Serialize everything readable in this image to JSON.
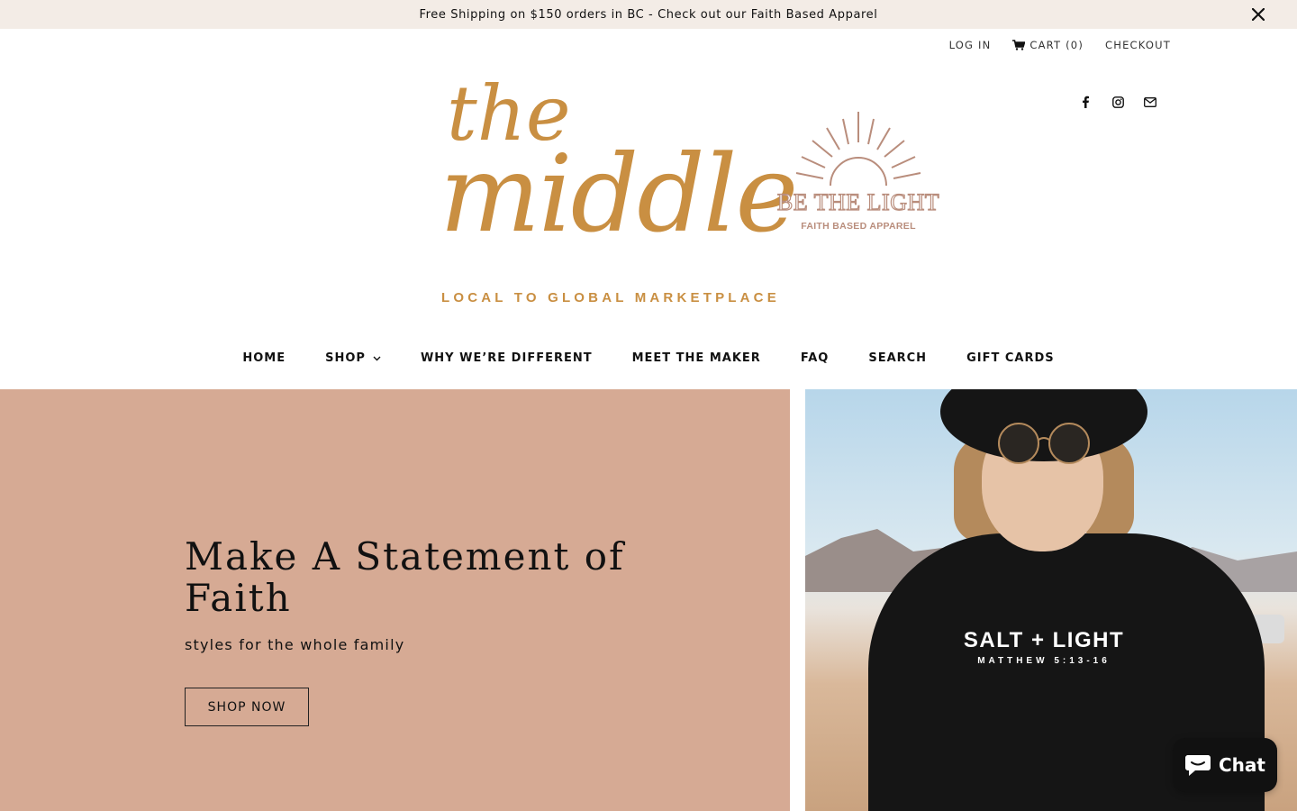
{
  "announcement": {
    "text": "Free Shipping on $150 orders in BC - Check out our Faith Based Apparel",
    "close_icon": "close-icon"
  },
  "account": {
    "login": "LOG IN",
    "cart": "CART (0)",
    "checkout": "CHECKOUT"
  },
  "social": [
    "facebook-icon",
    "instagram-icon",
    "mail-icon"
  ],
  "logo": {
    "line1": "the",
    "line2": "middle",
    "tagline": "LOCAL TO GLOBAL MARKETPLACE",
    "secondary_title": "BE THE LIGHT",
    "secondary_sub": "FAITH BASED APPAREL"
  },
  "nav": {
    "items": [
      {
        "label": "HOME"
      },
      {
        "label": "SHOP"
      },
      {
        "label": "WHY WE’RE DIFFERENT"
      },
      {
        "label": "MEET THE MAKER"
      },
      {
        "label": "FAQ"
      },
      {
        "label": "SEARCH"
      },
      {
        "label": "GIFT CARDS"
      }
    ]
  },
  "hero": {
    "title": "Make A Statement of Faith",
    "subtitle": "styles for the whole family",
    "button": "SHOP NOW",
    "image_text": "SALT + LIGHT",
    "image_subtext": "MATTHEW 5:13-16"
  },
  "chat": {
    "label": "Chat"
  },
  "colors": {
    "announcement_bg": "#f3ece6",
    "brand_gold": "#c98f42",
    "secondary_brand": "#b98d7c",
    "hero_bg": "#d6aa94"
  }
}
